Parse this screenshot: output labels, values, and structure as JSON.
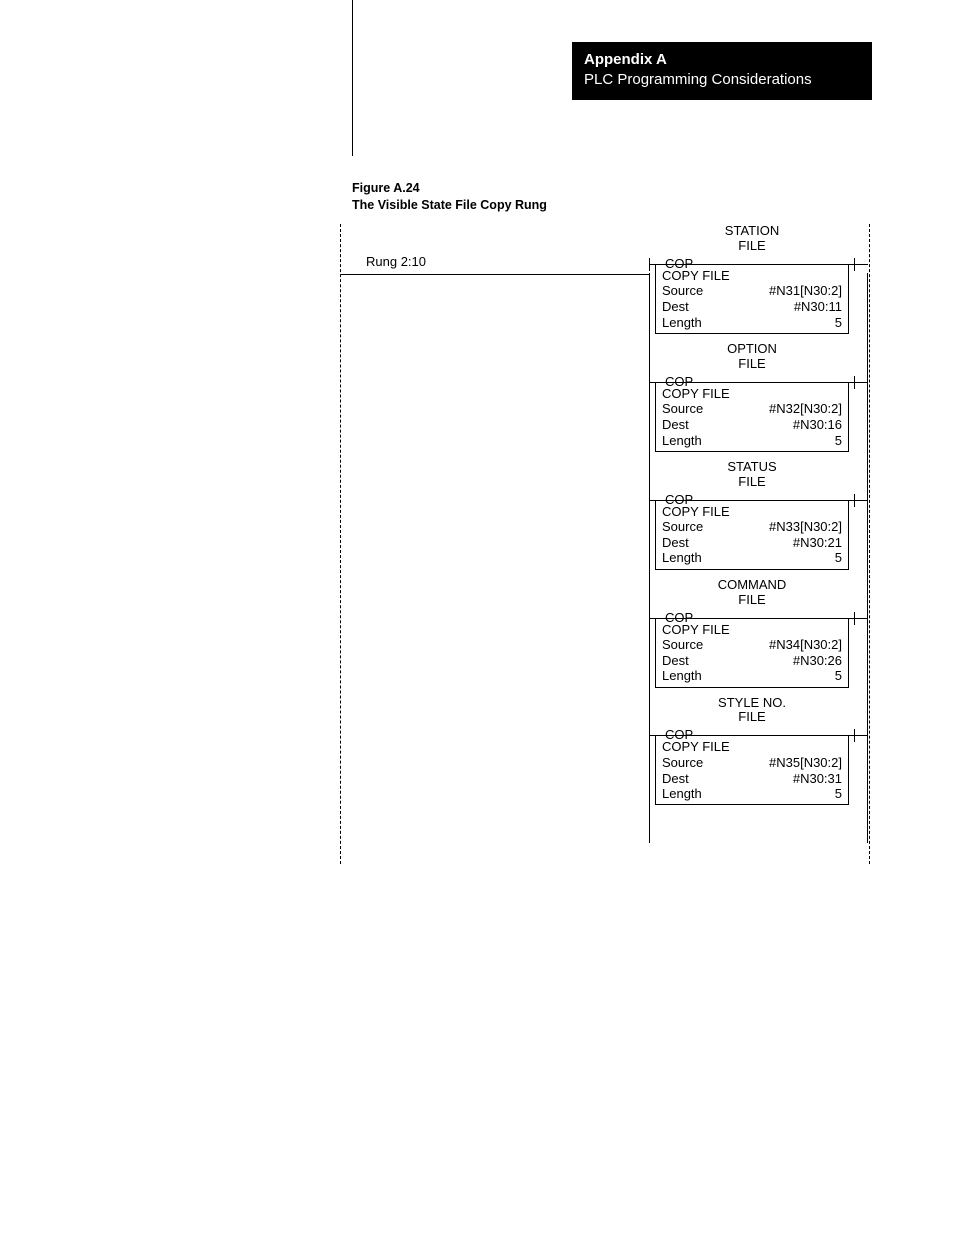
{
  "header": {
    "line1": "Appendix A",
    "line2": "PLC Programming Considerations"
  },
  "figure": {
    "number": "Figure A.24",
    "title": "The Visible State File Copy Rung"
  },
  "rung_label": "Rung 2:10",
  "mnemonic": "COP",
  "copy_file_label": "COPY FILE",
  "field_labels": {
    "source": "Source",
    "dest": "Dest",
    "length": "Length"
  },
  "blocks": [
    {
      "header1": "STATION",
      "header2": "FILE",
      "source": "#N31[N30:2]",
      "dest": "#N30:11",
      "length": "5"
    },
    {
      "header1": "OPTION",
      "header2": "FILE",
      "source": "#N32[N30:2]",
      "dest": "#N30:16",
      "length": "5"
    },
    {
      "header1": "STATUS",
      "header2": "FILE",
      "source": "#N33[N30:2]",
      "dest": "#N30:21",
      "length": "5"
    },
    {
      "header1": "COMMAND",
      "header2": "FILE",
      "source": "#N34[N30:2]",
      "dest": "#N30:26",
      "length": "5"
    },
    {
      "header1": "STYLE NO.",
      "header2": "FILE",
      "source": "#N35[N30:2]",
      "dest": "#N30:31",
      "length": "5"
    }
  ]
}
